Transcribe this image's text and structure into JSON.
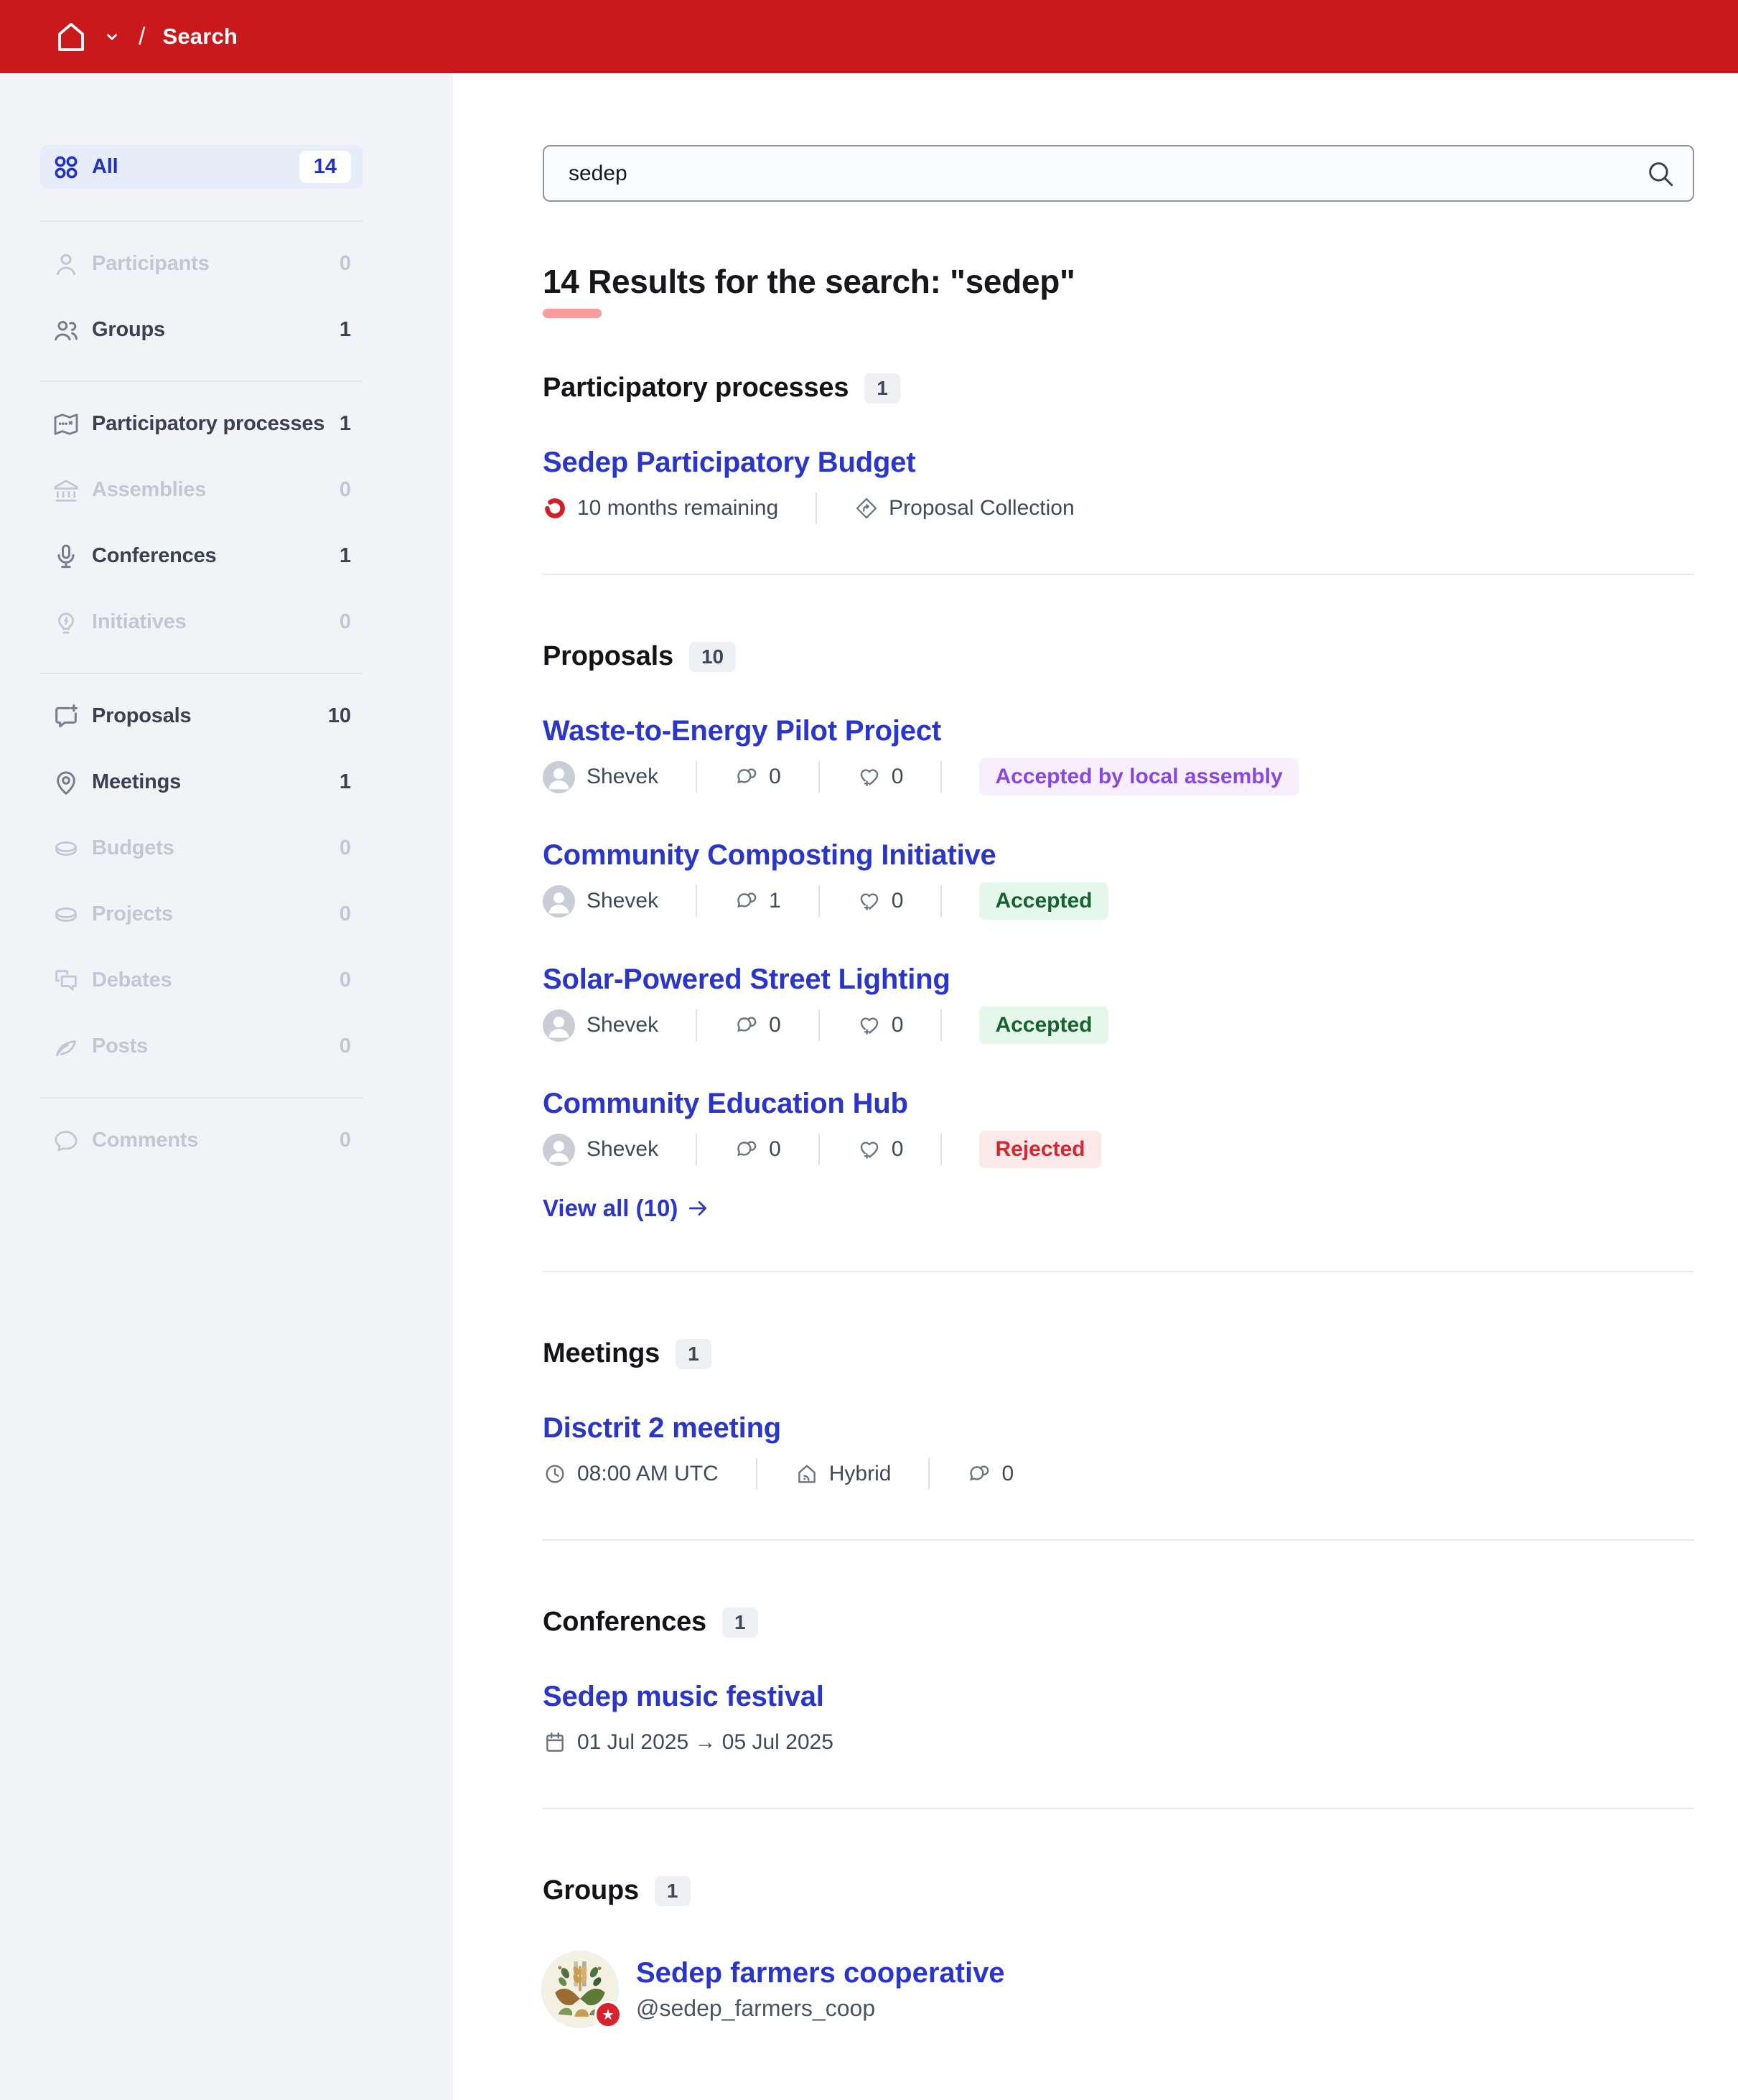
{
  "header": {
    "slash": "/",
    "title": "Search"
  },
  "sidebar": {
    "items": [
      {
        "label": "All",
        "count": "14",
        "state": "active",
        "icon": "apps"
      },
      {
        "label": "Participants",
        "count": "0",
        "state": "disabled",
        "icon": "user"
      },
      {
        "label": "Groups",
        "count": "1",
        "state": "normal",
        "icon": "team"
      },
      {
        "label": "Participatory processes",
        "count": "1",
        "state": "normal",
        "icon": "map"
      },
      {
        "label": "Assemblies",
        "count": "0",
        "state": "disabled",
        "icon": "bank"
      },
      {
        "label": "Conferences",
        "count": "1",
        "state": "normal",
        "icon": "mic"
      },
      {
        "label": "Initiatives",
        "count": "0",
        "state": "disabled",
        "icon": "lightbulb"
      },
      {
        "label": "Proposals",
        "count": "10",
        "state": "normal",
        "icon": "chat-new"
      },
      {
        "label": "Meetings",
        "count": "1",
        "state": "normal",
        "icon": "map-pin"
      },
      {
        "label": "Budgets",
        "count": "0",
        "state": "disabled",
        "icon": "coin"
      },
      {
        "label": "Projects",
        "count": "0",
        "state": "disabled",
        "icon": "coin"
      },
      {
        "label": "Debates",
        "count": "0",
        "state": "disabled",
        "icon": "debate"
      },
      {
        "label": "Posts",
        "count": "0",
        "state": "disabled",
        "icon": "quill"
      },
      {
        "label": "Comments",
        "count": "0",
        "state": "disabled",
        "icon": "chat"
      }
    ]
  },
  "search": {
    "value": "sedep"
  },
  "results": {
    "heading": "14 Results for the search: \"sedep\""
  },
  "sections": {
    "processes": {
      "title": "Participatory processes",
      "count": "1",
      "items": [
        {
          "title": "Sedep Participatory Budget",
          "remaining": "10 months remaining",
          "type": "Proposal Collection"
        }
      ]
    },
    "proposals": {
      "title": "Proposals",
      "count": "10",
      "view_all": "View all (10)",
      "items": [
        {
          "title": "Waste-to-Energy Pilot Project",
          "author": "Shevek",
          "comments": "0",
          "endorsements": "0",
          "status": "Accepted by local assembly"
        },
        {
          "title": "Community Composting Initiative",
          "author": "Shevek",
          "comments": "1",
          "endorsements": "0",
          "status": "Accepted"
        },
        {
          "title": "Solar-Powered Street Lighting",
          "author": "Shevek",
          "comments": "0",
          "endorsements": "0",
          "status": "Accepted"
        },
        {
          "title": "Community Education Hub",
          "author": "Shevek",
          "comments": "0",
          "endorsements": "0",
          "status": "Rejected"
        }
      ]
    },
    "meetings": {
      "title": "Meetings",
      "count": "1",
      "items": [
        {
          "title": "Disctrit 2 meeting",
          "time": "08:00 AM UTC",
          "mode": "Hybrid",
          "comments": "0"
        }
      ]
    },
    "conferences": {
      "title": "Conferences",
      "count": "1",
      "items": [
        {
          "title": "Sedep music festival",
          "dates": "01 Jul 2025 → 05 Jul 2025"
        }
      ]
    },
    "groups": {
      "title": "Groups",
      "count": "1",
      "items": [
        {
          "title": "Sedep farmers cooperative",
          "handle": "@sedep_farmers_coop"
        }
      ]
    }
  },
  "colors": {
    "header_red": "#C9191D",
    "link_blue": "#2A36C9",
    "active_bg": "#E7ECF9",
    "underline_salmon": "#FB9C9C",
    "badge_purple": "#8A47DF",
    "badge_green": "#176231",
    "badge_red": "#D42730",
    "timer_red": "#D21F26",
    "sidebar_bg": "#F2F3F7"
  }
}
